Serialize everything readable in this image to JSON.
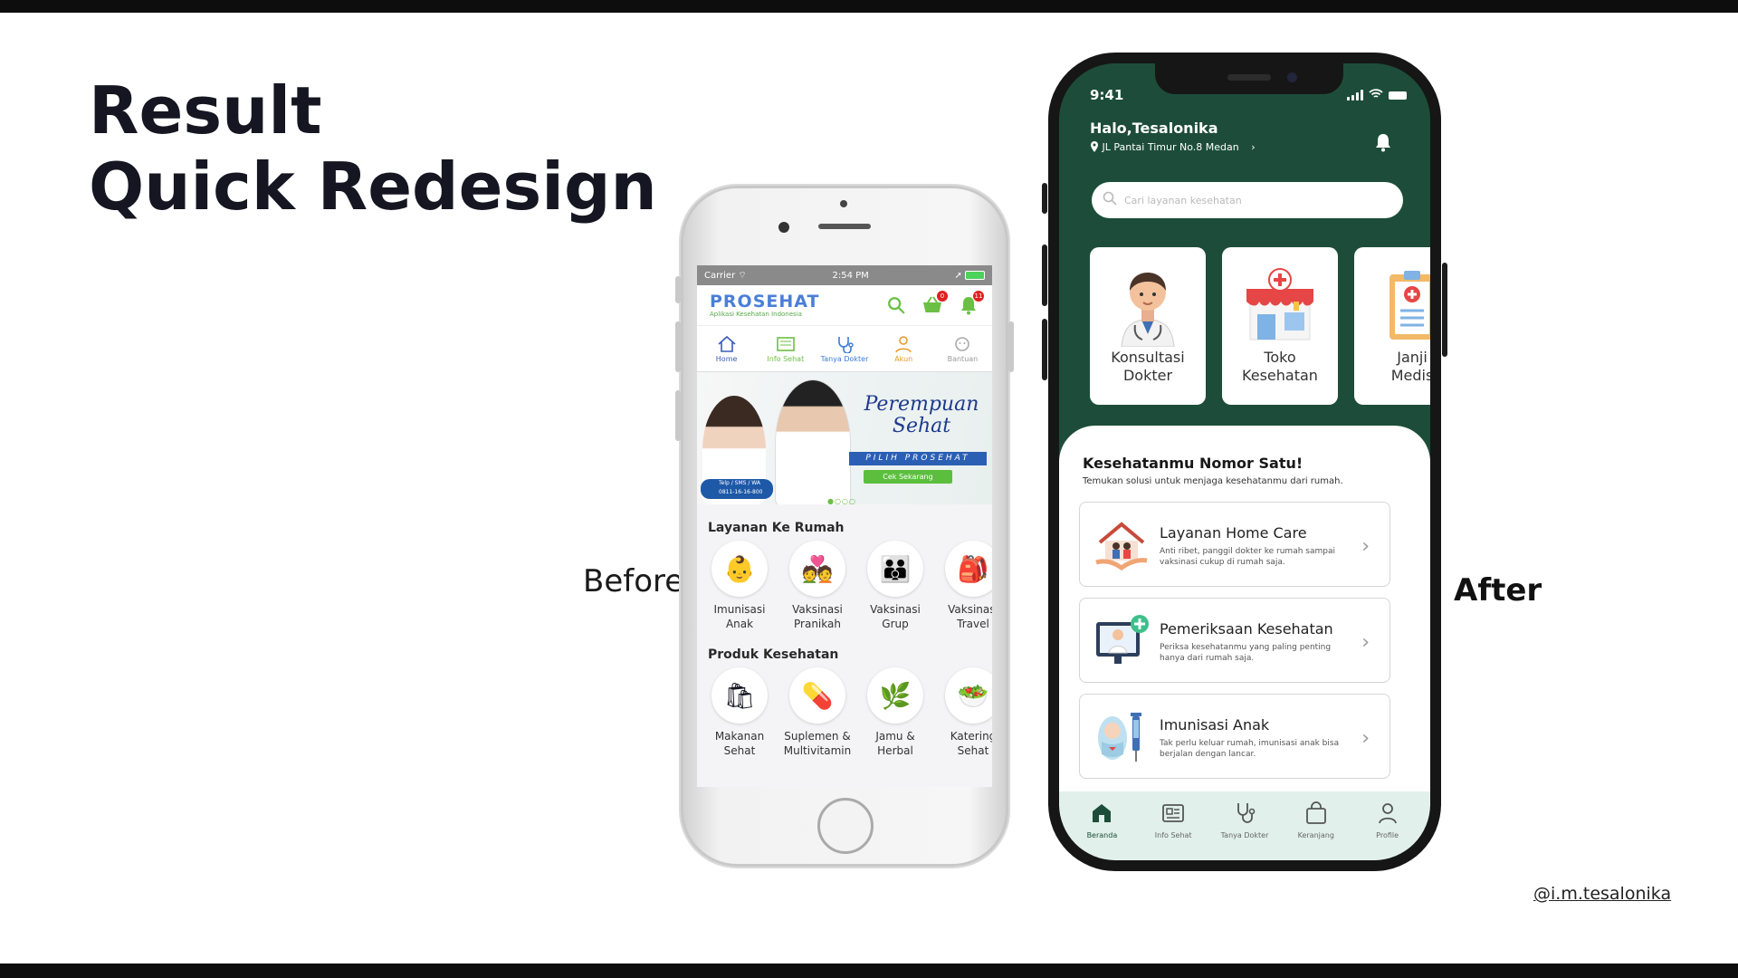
{
  "slide": {
    "title_line1": "Result",
    "title_line2": "Quick Redesign",
    "before_label": "Before",
    "after_label": "After",
    "credit": "@i.m.tesalonika"
  },
  "before": {
    "status": {
      "carrier": "Carrier",
      "time": "2:54 PM"
    },
    "brand": {
      "name": "PROSEHAT",
      "tagline": "Aplikasi Kesehatan Indonesia"
    },
    "header_icons": [
      {
        "icon": "search-icon"
      },
      {
        "icon": "basket-icon",
        "badge": "0"
      },
      {
        "icon": "bell-icon",
        "badge": "11"
      }
    ],
    "nav": [
      {
        "label": "Home",
        "color": "#3b5bb5"
      },
      {
        "label": "Info Sehat",
        "color": "#6bbf45"
      },
      {
        "label": "Tanya Dokter",
        "color": "#3b7bd8"
      },
      {
        "label": "Akun",
        "color": "#e89a2a"
      },
      {
        "label": "Bantuan",
        "color": "#999999"
      }
    ],
    "banner": {
      "title_line1": "Perempuan",
      "title_line2": "Sehat",
      "ribbon": "PILIH PROSEHAT",
      "button": "Cek Sekarang",
      "contact_label": "Telp / SMS / WA",
      "contact_number": "0811-16-16-800"
    },
    "layanan": {
      "title": "Layanan Ke Rumah",
      "items": [
        {
          "line1": "Imunisasi",
          "line2": "Anak",
          "icon": "baby-icon"
        },
        {
          "line1": "Vaksinasi",
          "line2": "Pranikah",
          "icon": "couple-icon"
        },
        {
          "line1": "Vaksinasi",
          "line2": "Grup",
          "icon": "group-icon"
        },
        {
          "line1": "Vaksinasi",
          "line2": "Travel",
          "icon": "backpack-icon"
        }
      ]
    },
    "produk": {
      "title": "Produk Kesehatan",
      "items": [
        {
          "line1": "Makanan",
          "line2": "Sehat",
          "icon": "grocery-bag-icon"
        },
        {
          "line1": "Suplemen &",
          "line2": "Multivitamin",
          "icon": "supplement-icon"
        },
        {
          "line1": "Jamu &",
          "line2": "Herbal",
          "icon": "herbal-icon"
        },
        {
          "line1": "Katering",
          "line2": "Sehat",
          "icon": "salad-icon"
        }
      ]
    }
  },
  "after": {
    "status": {
      "time": "9:41"
    },
    "greeting": "Halo,Tesalonika",
    "address": "JL Pantai Timur No.8 Medan",
    "search_placeholder": "Cari layanan kesehatan",
    "categories": [
      {
        "line1": "Konsultasi",
        "line2": "Dokter",
        "icon": "doctor-icon"
      },
      {
        "line1": "Toko",
        "line2": "Kesehatan",
        "icon": "pharmacy-store-icon"
      },
      {
        "line1": "Janji",
        "line2": "Medis",
        "icon": "clipboard-icon"
      }
    ],
    "sheet": {
      "title": "Kesehatanmu Nomor Satu!",
      "subtitle": "Temukan solusi untuk menjaga kesehatanmu dari rumah."
    },
    "services": [
      {
        "title": "Layanan Home Care",
        "desc": "Anti ribet, panggil dokter ke rumah sampai vaksinasi cukup di rumah saja.",
        "icon": "home-care-icon"
      },
      {
        "title": "Pemeriksaan Kesehatan",
        "desc": "Periksa kesehatanmu yang paling penting hanya dari rumah saja.",
        "icon": "checkup-icon"
      },
      {
        "title": "Imunisasi Anak",
        "desc": "Tak perlu keluar rumah, imunisasi anak bisa berjalan dengan lancar.",
        "icon": "syringe-icon"
      }
    ],
    "tabs": [
      {
        "label": "Beranda",
        "icon": "home-icon",
        "active": true
      },
      {
        "label": "Info Sehat",
        "icon": "news-icon"
      },
      {
        "label": "Tanya Dokter",
        "icon": "stethoscope-icon"
      },
      {
        "label": "Keranjang",
        "icon": "shopping-bag-icon"
      },
      {
        "label": "Profile",
        "icon": "user-icon"
      }
    ],
    "colors": {
      "primary": "#1d4d3a",
      "tabbar": "#e1f0ea"
    }
  }
}
